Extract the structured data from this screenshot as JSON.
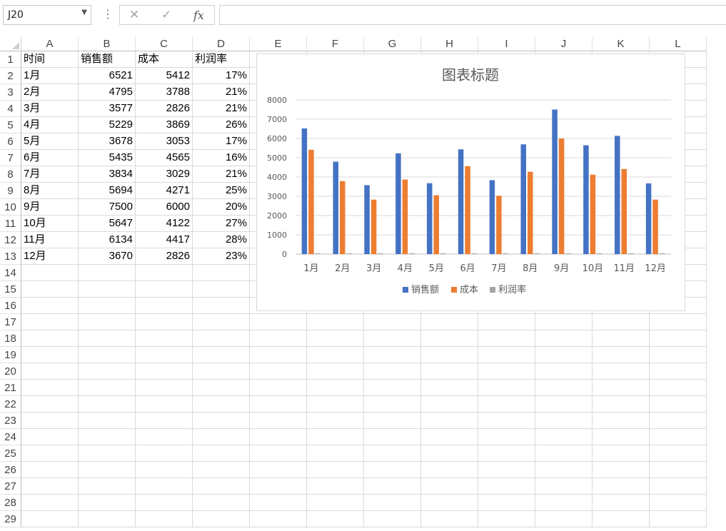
{
  "formula_bar": {
    "name_box": "J20",
    "fx_label": "fx",
    "formula": ""
  },
  "columns": [
    "A",
    "B",
    "C",
    "D",
    "E",
    "F",
    "G",
    "H",
    "I",
    "J",
    "K",
    "L"
  ],
  "rows": [
    "1",
    "2",
    "3",
    "4",
    "5",
    "6",
    "7",
    "8",
    "9",
    "10",
    "11",
    "12",
    "13",
    "14",
    "15",
    "16",
    "17",
    "18",
    "19",
    "20",
    "21",
    "22",
    "23",
    "24",
    "25",
    "26",
    "27",
    "28",
    "29"
  ],
  "sheet": {
    "headers": [
      "时间",
      "销售额",
      "成本",
      "利润率"
    ],
    "data": [
      [
        "1月",
        "6521",
        "5412",
        "17%"
      ],
      [
        "2月",
        "4795",
        "3788",
        "21%"
      ],
      [
        "3月",
        "3577",
        "2826",
        "21%"
      ],
      [
        "4月",
        "5229",
        "3869",
        "26%"
      ],
      [
        "5月",
        "3678",
        "3053",
        "17%"
      ],
      [
        "6月",
        "5435",
        "4565",
        "16%"
      ],
      [
        "7月",
        "3834",
        "3029",
        "21%"
      ],
      [
        "8月",
        "5694",
        "4271",
        "25%"
      ],
      [
        "9月",
        "7500",
        "6000",
        "20%"
      ],
      [
        "10月",
        "5647",
        "4122",
        "27%"
      ],
      [
        "11月",
        "6134",
        "4417",
        "28%"
      ],
      [
        "12月",
        "3670",
        "2826",
        "23%"
      ]
    ]
  },
  "chart_data": {
    "type": "bar",
    "title": "图表标题",
    "categories": [
      "1月",
      "2月",
      "3月",
      "4月",
      "5月",
      "6月",
      "7月",
      "8月",
      "9月",
      "10月",
      "11月",
      "12月"
    ],
    "series": [
      {
        "name": "销售额",
        "color": "#4472c4",
        "values": [
          6521,
          4795,
          3577,
          5229,
          3678,
          5435,
          3834,
          5694,
          7500,
          5647,
          6134,
          3670
        ]
      },
      {
        "name": "成本",
        "color": "#ed7d31",
        "values": [
          5412,
          3788,
          2826,
          3869,
          3053,
          4565,
          3029,
          4271,
          6000,
          4122,
          4417,
          2826
        ]
      },
      {
        "name": "利润率",
        "color": "#a5a5a5",
        "values": [
          0.17,
          0.21,
          0.21,
          0.26,
          0.17,
          0.16,
          0.21,
          0.25,
          0.2,
          0.27,
          0.28,
          0.23
        ]
      }
    ],
    "ylim": [
      0,
      8000
    ],
    "yticks": [
      "0",
      "1000",
      "2000",
      "3000",
      "4000",
      "5000",
      "6000",
      "7000",
      "8000"
    ],
    "grid": true,
    "legend": "bottom"
  }
}
